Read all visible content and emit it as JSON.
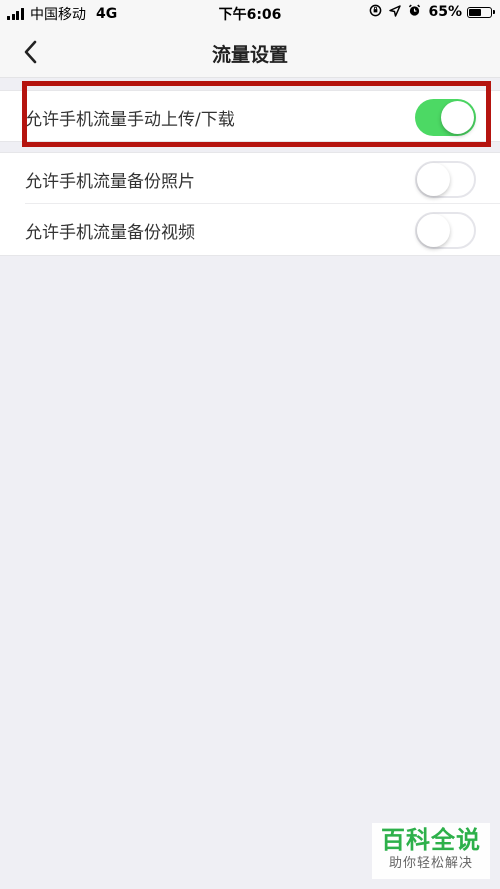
{
  "status_bar": {
    "carrier": "中国移动",
    "network": "4G",
    "time": "下午6:06",
    "battery_percent": "65%",
    "battery_level": 0.65
  },
  "navbar": {
    "title": "流量设置"
  },
  "settings": [
    {
      "label": "允许手机流量手动上传/下载",
      "enabled": true
    },
    {
      "label": "允许手机流量备份照片",
      "enabled": false
    },
    {
      "label": "允许手机流量备份视频",
      "enabled": false
    }
  ],
  "watermark": {
    "main": "百科全说",
    "sub": "助你轻松解决"
  },
  "colors": {
    "switch_on": "#4cd964",
    "highlight": "#b5140f",
    "watermark": "#2db04a"
  }
}
